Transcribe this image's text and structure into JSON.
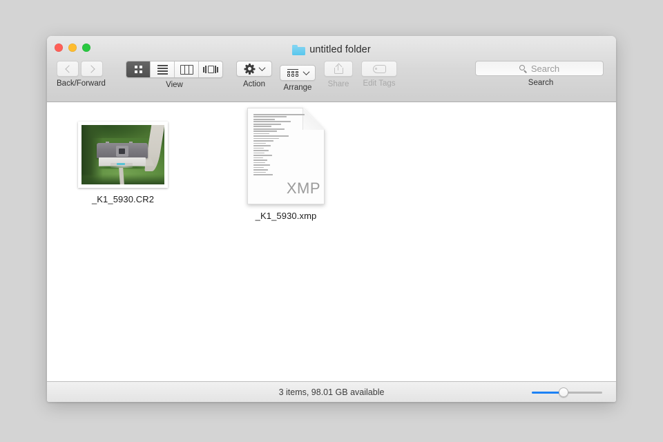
{
  "window": {
    "title": "untitled folder",
    "folder_icon": "folder-icon",
    "traffic_lights": {
      "close": "close-button",
      "minimize": "minimize-button",
      "zoom": "maximize-button",
      "close_color": "#ff5f57",
      "minimize_color": "#febc2e",
      "zoom_color": "#28c840"
    }
  },
  "toolbar": {
    "back_forward_label": "Back/Forward",
    "view_label": "View",
    "action_label": "Action",
    "arrange_label": "Arrange",
    "share_label": "Share",
    "edit_tags_label": "Edit Tags",
    "search_label": "Search",
    "view_modes": [
      {
        "name": "icon-view",
        "selected": true
      },
      {
        "name": "list-view",
        "selected": false
      },
      {
        "name": "column-view",
        "selected": false
      },
      {
        "name": "coverflow-view",
        "selected": false
      }
    ]
  },
  "search": {
    "placeholder": "Search",
    "value": ""
  },
  "files": [
    {
      "name": "_K1_5930.CR2",
      "kind": "photo-thumbnail"
    },
    {
      "name": "_K1_5930.xmp",
      "kind": "xmp-document",
      "extension_label": "XMP"
    }
  ],
  "statusbar": {
    "text": "3 items, 98.01 GB available",
    "zoom_slider": {
      "value": 45,
      "fill_color": "#1d82f5"
    }
  }
}
